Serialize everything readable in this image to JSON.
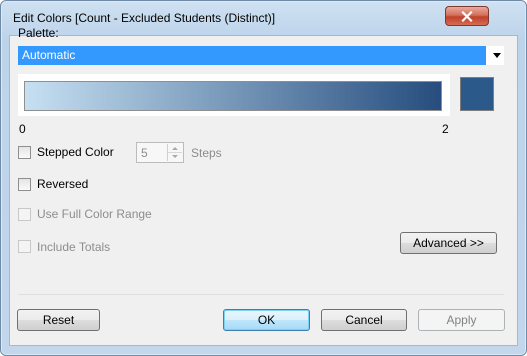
{
  "window": {
    "title": "Edit Colors [Count - Excluded Students (Distinct)]"
  },
  "palette": {
    "label": "Palette:",
    "selected": "Automatic"
  },
  "ramp": {
    "min_label": "0",
    "max_label": "2",
    "start_color": "#c6e0f2",
    "end_color": "#264d7e",
    "swatch_color": "#2b5a8a"
  },
  "options": {
    "stepped_color": {
      "label": "Stepped Color",
      "checked": false
    },
    "steps": {
      "value": "5",
      "unit_label": "Steps"
    },
    "reversed": {
      "label": "Reversed",
      "checked": false
    },
    "use_full_range": {
      "label": "Use Full Color Range",
      "checked": false,
      "enabled": false
    },
    "include_totals": {
      "label": "Include Totals",
      "checked": false,
      "enabled": false
    }
  },
  "buttons": {
    "advanced": "Advanced >>",
    "reset": "Reset",
    "ok": "OK",
    "cancel": "Cancel",
    "apply": "Apply"
  },
  "colors": {
    "selection_blue": "#3399ff",
    "close_red": "#c0402a"
  }
}
